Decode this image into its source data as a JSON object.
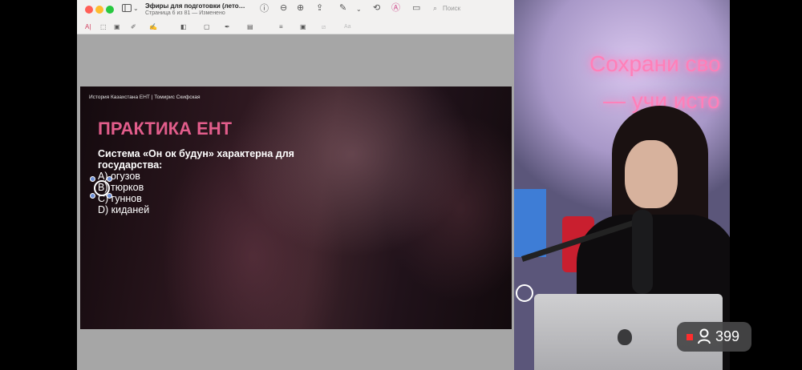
{
  "preview_window": {
    "title": "Эфиры для подготовки (лето…",
    "subtitle": "Страница 6 из 81 — Изменено",
    "search_placeholder": "Поиск"
  },
  "slide": {
    "header": "История Казахстана ЕНТ | Томирис Скифская",
    "title": "ПРАКТИКА ЕНТ",
    "question": "Система «Он ок будун» характерна для государства:",
    "options": [
      "A) огузов",
      "B) тюрков",
      "C) гуннов",
      "D) киданей"
    ],
    "title_color": "#e25d8b"
  },
  "camera": {
    "neon_line1": "Сохрани сво",
    "neon_line2": "— учи исто"
  },
  "live": {
    "viewer_count": "399",
    "status_color": "#ff2d2d"
  },
  "icons": [
    "sidebar-toggle-icon",
    "chevron-down-icon",
    "info-icon",
    "zoom-out-icon",
    "zoom-in-icon",
    "share-icon",
    "rotate-icon",
    "markup-pen-icon",
    "highlight-icon",
    "signature-icon",
    "search-icon",
    "text-tool-icon",
    "selection-icon",
    "shapes-icon",
    "viewer-person-icon"
  ]
}
